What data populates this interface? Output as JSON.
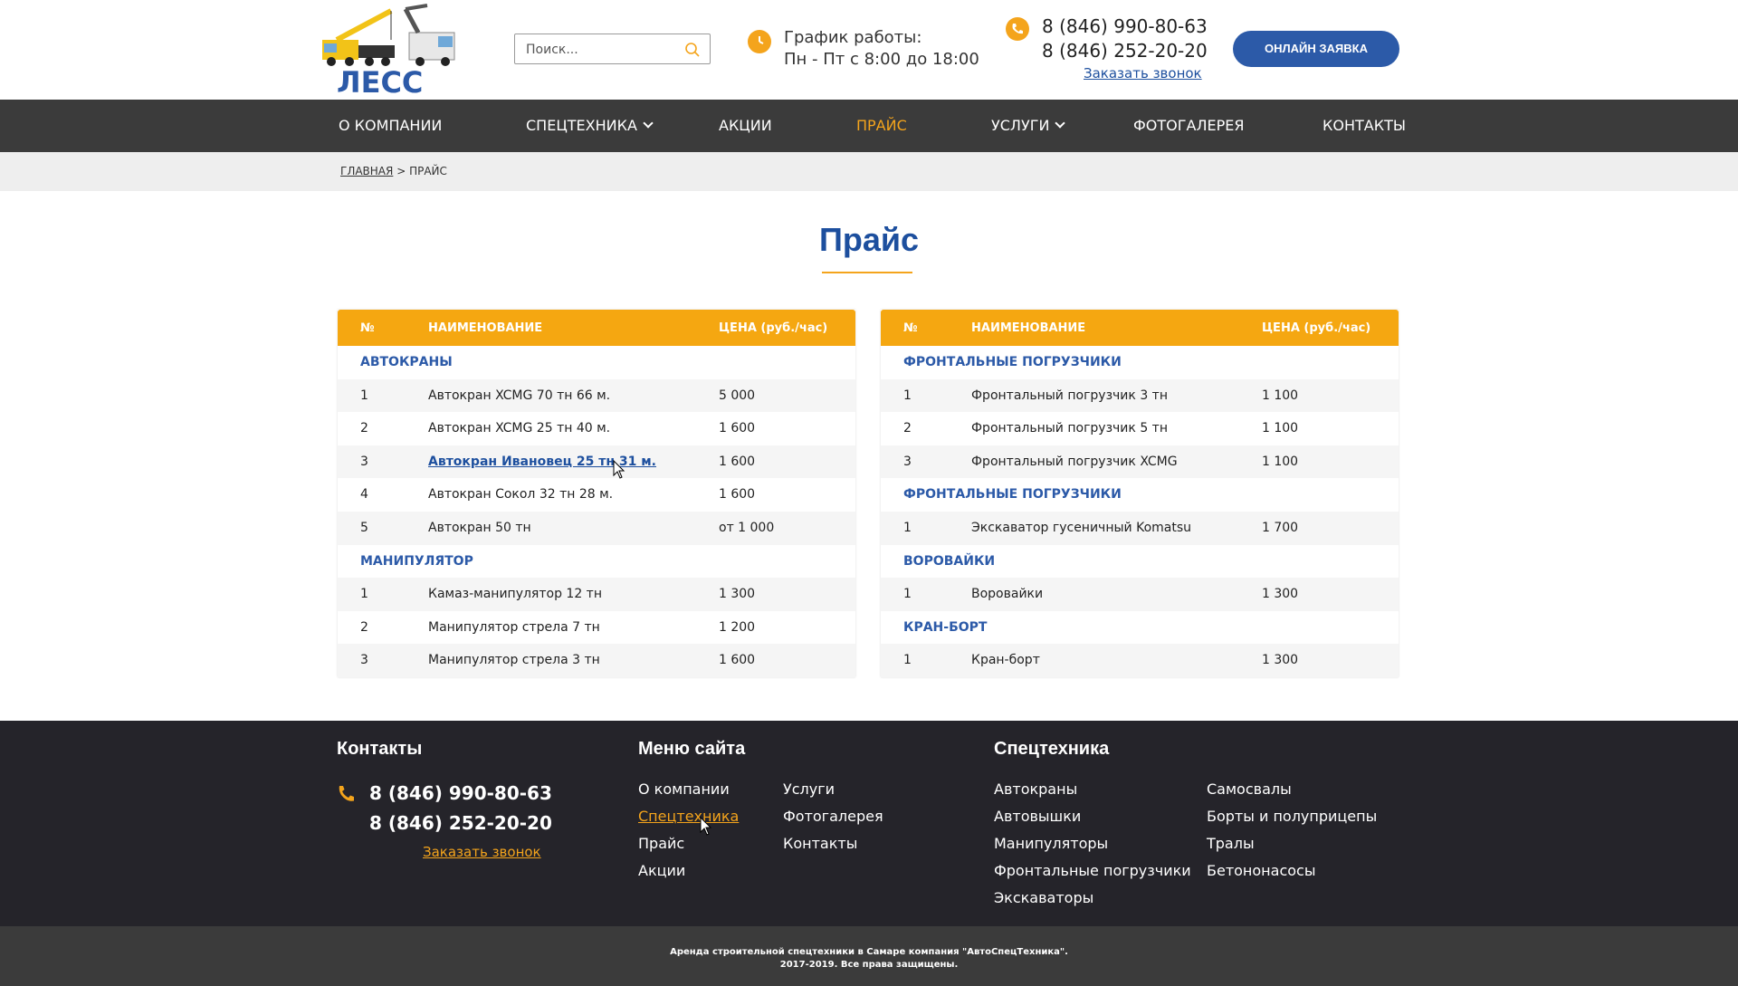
{
  "header": {
    "logo_text": "ЛЕСС",
    "search_placeholder": "Поиск...",
    "schedule_line1": "График работы:",
    "schedule_line2": "Пн - Пт с 8:00 до 18:00",
    "phone1": "8 (846) 990-80-63",
    "phone2": "8 (846) 252-20-20",
    "callback": "Заказать звонок",
    "online_button": "ОНЛАЙН ЗАЯВКА"
  },
  "nav": {
    "items": [
      {
        "label": "О КОМПАНИИ"
      },
      {
        "label": "СПЕЦТЕХНИКА"
      },
      {
        "label": "АКЦИИ"
      },
      {
        "label": "ПРАЙС"
      },
      {
        "label": "УСЛУГИ"
      },
      {
        "label": "ФОТОГАЛЕРЕЯ"
      },
      {
        "label": "КОНТАКТЫ"
      }
    ]
  },
  "breadcrumb": {
    "home": "ГЛАВНАЯ",
    "separator": ">",
    "current": "ПРАЙС"
  },
  "page_title": "Прайс",
  "table_headers": {
    "num": "№",
    "name": "НАИМЕНОВАНИЕ",
    "price": "ЦЕНА (руб./час)"
  },
  "left_table": [
    {
      "category": "АВТОКРАНЫ",
      "rows": [
        {
          "n": "1",
          "name": "Автокран XCMG 70 тн 66 м.",
          "price": "5 000"
        },
        {
          "n": "2",
          "name": "Автокран XCMG 25 тн 40 м.",
          "price": "1 600"
        },
        {
          "n": "3",
          "name": "Автокран Ивановец 25 тн 31 м.",
          "price": "1 600"
        },
        {
          "n": "4",
          "name": "Автокран Сокол 32 тн 28 м.",
          "price": "1 600"
        },
        {
          "n": "5",
          "name": "Автокран 50 тн",
          "price": "от 1 000"
        }
      ]
    },
    {
      "category": "МАНИПУЛЯТОР",
      "rows": [
        {
          "n": "1",
          "name": "Камаз-манипулятор 12 тн",
          "price": "1 300"
        },
        {
          "n": "2",
          "name": "Манипулятор стрела 7 тн",
          "price": "1 200"
        },
        {
          "n": "3",
          "name": "Манипулятор стрела 3 тн",
          "price": "1 600"
        }
      ]
    }
  ],
  "right_table": [
    {
      "category": "ФРОНТАЛЬНЫЕ ПОГРУЗЧИКИ",
      "rows": [
        {
          "n": "1",
          "name": "Фронтальный погрузчик 3 тн",
          "price": "1 100"
        },
        {
          "n": "2",
          "name": "Фронтальный погрузчик 5 тн",
          "price": "1 100"
        },
        {
          "n": "3",
          "name": "Фронтальный погрузчик XCMG",
          "price": "1 100"
        }
      ]
    },
    {
      "category": "ФРОНТАЛЬНЫЕ ПОГРУЗЧИКИ",
      "rows": [
        {
          "n": "1",
          "name": "Экскаватор гусеничный Komatsu",
          "price": "1 700"
        }
      ]
    },
    {
      "category": "ВОРОВАЙКИ",
      "rows": [
        {
          "n": "1",
          "name": "Воровайки",
          "price": "1 300"
        }
      ]
    },
    {
      "category": "КРАН-БОРТ",
      "rows": [
        {
          "n": "1",
          "name": "Кран-борт",
          "price": "1 300"
        }
      ]
    }
  ],
  "footer": {
    "contacts_heading": "Контакты",
    "phone1": "8 (846) 990-80-63",
    "phone2": "8 (846) 252-20-20",
    "callback": "Заказать звонок",
    "menu_heading": "Меню сайта",
    "menu_col1": [
      "О компании",
      "Спецтехника",
      "Прайс",
      "Акции"
    ],
    "menu_col2": [
      "Услуги",
      "Фотогалерея",
      "Контакты"
    ],
    "tech_heading": "Спецтехника",
    "tech_col1": [
      "Автокраны",
      "Автовышки",
      "Манипуляторы",
      "Фронтальные погрузчики",
      "Экскаваторы"
    ],
    "tech_col2": [
      "Самосвалы",
      "Борты и полуприцепы",
      "Тралы",
      "Бетононасосы"
    ],
    "copyright_line1": "Аренда строительной спецтехники в Самаре компания \"АвтоСпецТехника\".",
    "copyright_line2": "2017-2019. Все права защищены."
  },
  "colors": {
    "accent": "#f4a41c",
    "brand_blue": "#2c5aa8",
    "nav_bg": "#3b3b3b",
    "footer_bg": "#25242a"
  }
}
